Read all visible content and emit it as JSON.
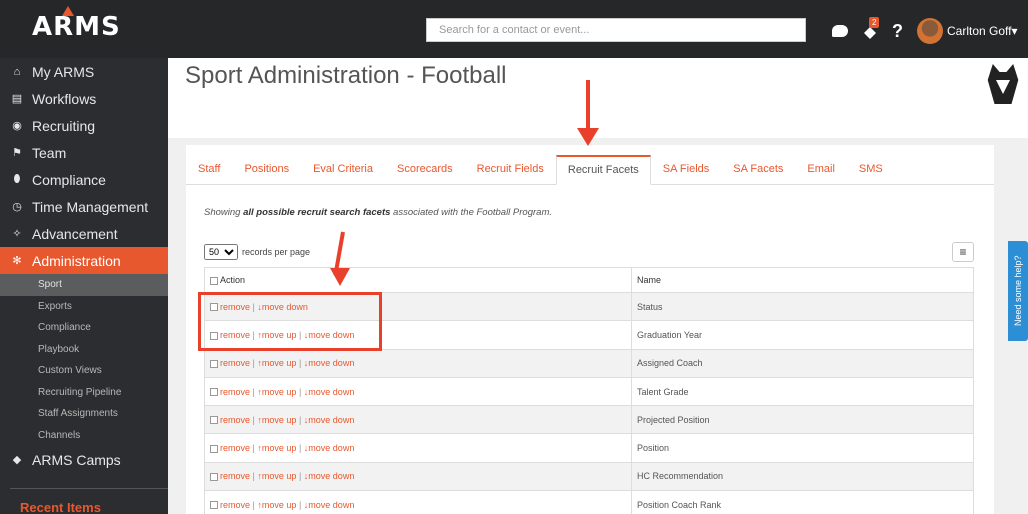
{
  "app": {
    "logo_text": "ARMS"
  },
  "header": {
    "search_placeholder": "Search for a contact or event...",
    "notification_count": "2",
    "help_label": "?",
    "user_name": "Carlton Goff"
  },
  "sidebar": {
    "items": [
      {
        "label": "My ARMS",
        "icon": "home-icon",
        "glyph": "⌂"
      },
      {
        "label": "Workflows",
        "icon": "workflows-icon",
        "glyph": "▤"
      },
      {
        "label": "Recruiting",
        "icon": "recruiting-icon",
        "glyph": "◉"
      },
      {
        "label": "Team",
        "icon": "team-icon",
        "glyph": "⚑"
      },
      {
        "label": "Compliance",
        "icon": "compliance-icon",
        "glyph": "⬮"
      },
      {
        "label": "Time Management",
        "icon": "clock-icon",
        "glyph": "◷"
      },
      {
        "label": "Advancement",
        "icon": "handshake-icon",
        "glyph": "✧"
      },
      {
        "label": "Administration",
        "icon": "gear-icon",
        "glyph": "✻"
      }
    ],
    "subitems": [
      "Sport",
      "Exports",
      "Compliance",
      "Playbook",
      "Custom Views",
      "Recruiting Pipeline",
      "Staff Assignments",
      "Channels"
    ],
    "camps": {
      "label": "ARMS Camps",
      "glyph": "◆"
    },
    "recent_label": "Recent Items"
  },
  "main": {
    "title": "Sport Administration - Football",
    "tabs": [
      "Staff",
      "Positions",
      "Eval Criteria",
      "Scorecards",
      "Recruit Fields",
      "Recruit Facets",
      "SA Fields",
      "SA Facets",
      "Email",
      "SMS"
    ],
    "active_tab": "Recruit Facets",
    "showing_prefix": "Showing ",
    "showing_bold": "all possible recruit search facets",
    "showing_suffix": " associated with the Football Program.",
    "per_page_value": "50",
    "per_page_label": "records per page",
    "menu_glyph": "≡",
    "table": {
      "headers": [
        "Action",
        "Name"
      ],
      "remove_label": "remove",
      "move_up_label": "move up",
      "move_down_label": "move down",
      "rows": [
        {
          "name": "Status",
          "move_up": false
        },
        {
          "name": "Graduation Year",
          "move_up": true
        },
        {
          "name": "Assigned Coach",
          "move_up": true
        },
        {
          "name": "Talent Grade",
          "move_up": true
        },
        {
          "name": "Projected Position",
          "move_up": true
        },
        {
          "name": "Position",
          "move_up": true
        },
        {
          "name": "HC Recommendation",
          "move_up": true
        },
        {
          "name": "Position Coach Rank",
          "move_up": true
        }
      ]
    }
  },
  "help_tab": "Need some help?",
  "colors": {
    "accent": "#e8582f",
    "annotation": "#e8402a",
    "topbar": "#252729",
    "sidebar": "#2b2d30",
    "help": "#2c8fd6"
  }
}
